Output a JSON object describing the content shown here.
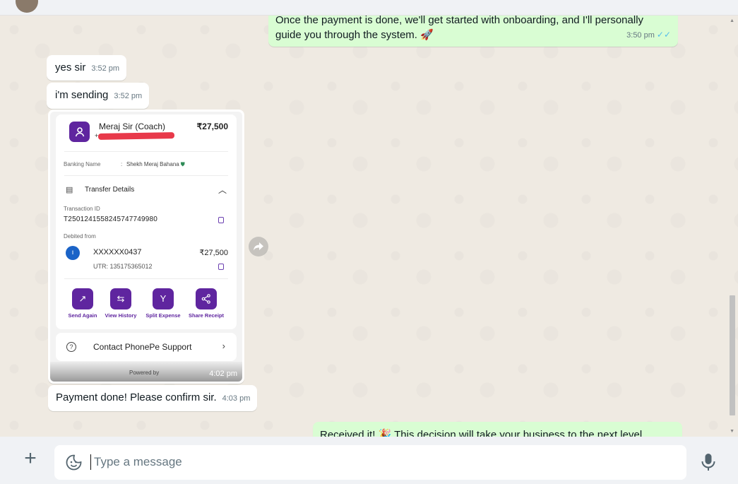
{
  "messages": {
    "out_top": {
      "text_line1": "Once the payment is done, we'll get started with onboarding, and I'll personally",
      "text_line2": "guide you through the system.",
      "emoji": "🚀",
      "time": "3:50 pm"
    },
    "yes_sir": {
      "text": "yes sir",
      "time": "3:52 pm"
    },
    "sending": {
      "text": "i'm sending",
      "time": "3:52 pm"
    },
    "image_time": "4:02 pm",
    "payment_done": {
      "text": "Payment done! Please confirm sir.",
      "time": "4:03 pm"
    },
    "out_bottom": {
      "text_before": "Received it!",
      "emoji": "🎉",
      "text_after": "This decision will take your business to the next level."
    }
  },
  "receipt": {
    "payee_name": "Meraj Sir (Coach)",
    "payee_number_prefix": "+",
    "amount": "₹27,500",
    "banking_name_label": "Banking Name",
    "banking_name_sep": ":",
    "banking_name_value": "Shekh Meraj Bahana",
    "transfer_details_label": "Transfer Details",
    "transaction_id_label": "Transaction ID",
    "transaction_id": "T2501241558245747749980",
    "debited_from_label": "Debited from",
    "account": "XXXXXX0437",
    "account_amount": "₹27,500",
    "utr": "UTR: 135175365012",
    "actions": [
      {
        "label": "Send Again",
        "icon": "arrow-up-right-icon"
      },
      {
        "label": "View History",
        "icon": "swap-arrows-icon"
      },
      {
        "label": "Split Expense",
        "icon": "split-icon"
      },
      {
        "label": "Share Receipt",
        "icon": "share-icon"
      }
    ],
    "support_label": "Contact PhonePe Support",
    "powered_by": "Powered by"
  },
  "composer": {
    "placeholder": "Type a message"
  },
  "colors": {
    "chat_bg": "#efeae2",
    "outgoing_bubble": "#d9fdd3",
    "incoming_bubble": "#ffffff",
    "phonepe_purple": "#5f259f",
    "read_ticks": "#53bdeb"
  }
}
